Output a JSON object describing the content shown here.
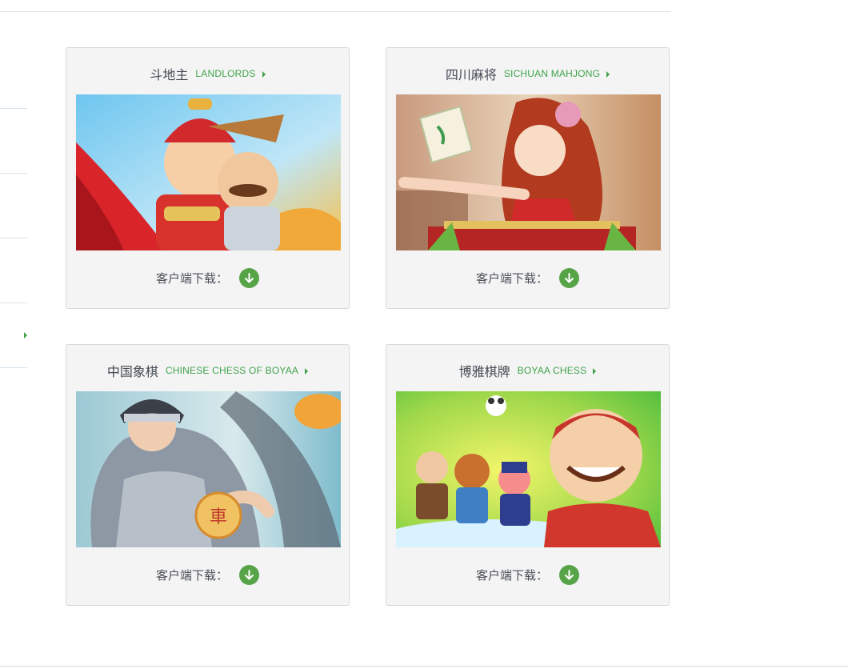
{
  "cards": [
    {
      "cn": "斗地主",
      "en": "LANDLORDS",
      "download_label": "客户端下载："
    },
    {
      "cn": "四川麻将",
      "en": "SICHUAN MAHJONG",
      "download_label": "客户端下载："
    },
    {
      "cn": "中国象棋",
      "en": "CHINESE CHESS OF BOYAA",
      "download_label": "客户端下载："
    },
    {
      "cn": "博雅棋牌",
      "en": "BOYAA CHESS",
      "download_label": "客户端下载："
    }
  ],
  "icons": {
    "title_arrow": "caret-right-icon",
    "download": "download-arrow-icon"
  },
  "colors": {
    "accent_green": "#3fa34a",
    "download_green": "#56a447",
    "card_bg": "#f4f4f5",
    "card_border": "#d5d8dc"
  }
}
